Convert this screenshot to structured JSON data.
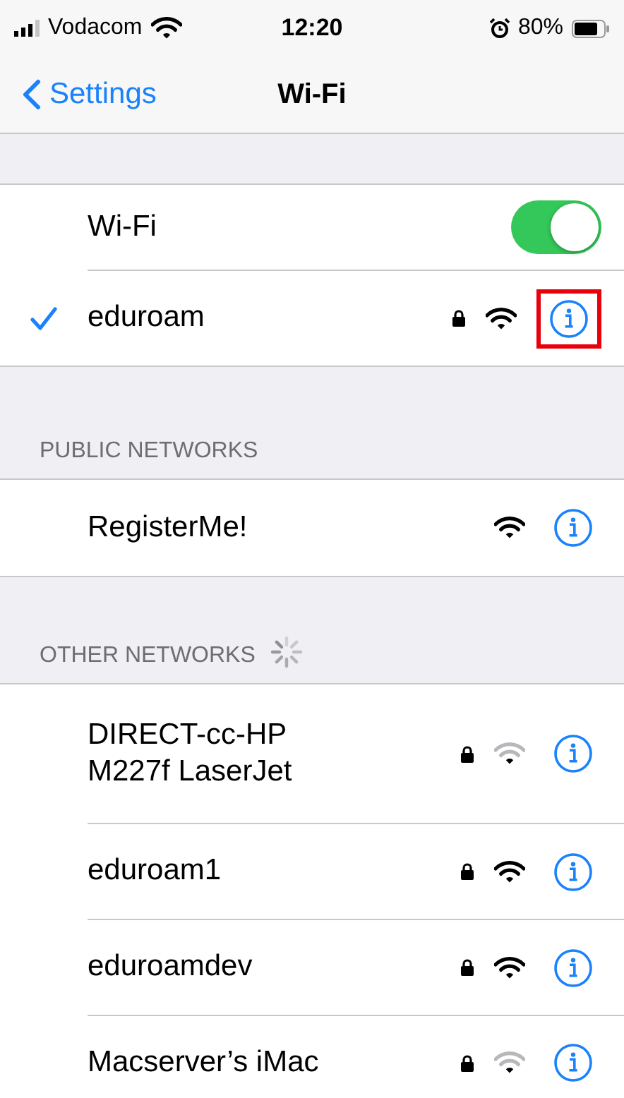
{
  "status_bar": {
    "carrier": "Vodacom",
    "time": "12:20",
    "battery": "80%"
  },
  "nav": {
    "back": "Settings",
    "title": "Wi-Fi"
  },
  "wifi_toggle": {
    "label": "Wi-Fi",
    "on": true
  },
  "current_network": {
    "name": "eduroam",
    "selected": true,
    "secured": true,
    "weak_signal": false,
    "highlighted": true
  },
  "sections": [
    {
      "title": "PUBLIC NETWORKS",
      "loading": false,
      "networks": [
        {
          "name": "RegisterMe!",
          "secured": false,
          "weak_signal": false,
          "highlighted": false
        }
      ]
    },
    {
      "title": "OTHER NETWORKS",
      "loading": true,
      "networks": [
        {
          "name": "DIRECT-cc-HP\nM227f LaserJet",
          "secured": true,
          "weak_signal": true,
          "highlighted": false
        },
        {
          "name": "eduroam1",
          "secured": true,
          "weak_signal": false,
          "highlighted": false
        },
        {
          "name": "eduroamdev",
          "secured": true,
          "weak_signal": false,
          "highlighted": false
        },
        {
          "name": "Macserver’s iMac",
          "secured": true,
          "weak_signal": true,
          "highlighted": false
        }
      ]
    }
  ]
}
